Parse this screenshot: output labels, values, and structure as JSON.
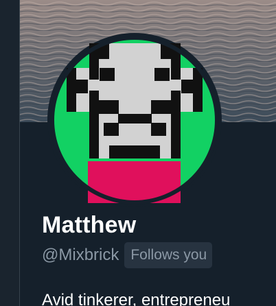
{
  "profile": {
    "name": "Matthew",
    "handle": "@Mixbrick",
    "follows_badge": "Follows you",
    "bio": "Avid tinkerer, entrepreneu"
  },
  "colors": {
    "background": "#15202b",
    "avatar_background": "#12d163",
    "pixel_dark": "#111111",
    "pixel_light": "#d2d2d2",
    "pixel_accent": "#e0105c",
    "secondary_text": "#8b98a5",
    "badge_background": "#273340"
  },
  "icons": {
    "avatar": "pixel-art-avatar-icon",
    "header": "water-header-image"
  }
}
